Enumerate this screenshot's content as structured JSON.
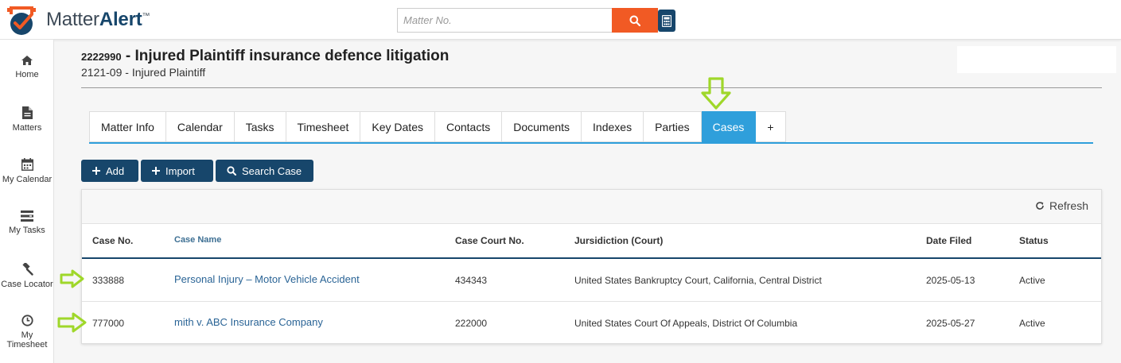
{
  "header": {
    "logo_text_light": "Matter",
    "logo_text_bold": "Alert",
    "logo_tm": "™",
    "search_placeholder": "Matter No.",
    "search_icon": "search-icon",
    "calculator_icon": "calculator-icon"
  },
  "sidebar": {
    "items": [
      {
        "label": "Home",
        "icon": "home-icon"
      },
      {
        "label": "Matters",
        "icon": "document-icon"
      },
      {
        "label": "My Calendar",
        "icon": "calendar-icon"
      },
      {
        "label": "My Tasks",
        "icon": "tasks-icon"
      },
      {
        "label": "Case Locator",
        "icon": "gavel-icon"
      },
      {
        "label": "My Timesheet",
        "icon": "clock-icon"
      }
    ]
  },
  "matter": {
    "number": "2222990",
    "title": " - Injured Plaintiff insurance defence litigation",
    "subtitle": "2121-09 - Injured Plaintiff"
  },
  "tabs": [
    {
      "label": "Matter Info",
      "active": false
    },
    {
      "label": "Calendar",
      "active": false
    },
    {
      "label": "Tasks",
      "active": false
    },
    {
      "label": "Timesheet",
      "active": false
    },
    {
      "label": "Key Dates",
      "active": false
    },
    {
      "label": "Contacts",
      "active": false
    },
    {
      "label": "Documents",
      "active": false
    },
    {
      "label": "Indexes",
      "active": false
    },
    {
      "label": "Parties",
      "active": false
    },
    {
      "label": "Cases",
      "active": true
    },
    {
      "label": "+",
      "active": false
    }
  ],
  "actions": {
    "add": "Add",
    "import": "Import",
    "search_case": "Search Case"
  },
  "panel": {
    "refresh": "Refresh"
  },
  "table": {
    "headers": {
      "case_no": "Case No.",
      "case_name": "Case Name",
      "court_no": "Case Court No.",
      "jurisdiction": "Jursidiction (Court)",
      "date_filed": "Date Filed",
      "status": "Status"
    },
    "rows": [
      {
        "case_no": "333888",
        "case_name": "Personal Injury – Motor Vehicle Accident",
        "court_no": "434343",
        "jurisdiction": "United States Bankruptcy Court, California, Central District",
        "date_filed": "2025-05-13",
        "status": "Active"
      },
      {
        "case_no": "777000",
        "case_name": "mith v. ABC Insurance Company",
        "court_no": "222000",
        "jurisdiction": "United States Court Of Appeals, District Of Columbia",
        "date_filed": "2025-05-27",
        "status": "Active"
      }
    ]
  },
  "colors": {
    "brand_navy": "#17466b",
    "accent_orange": "#f15a24",
    "tab_active": "#2f9fdb",
    "annotation_green": "#9fd72a"
  }
}
